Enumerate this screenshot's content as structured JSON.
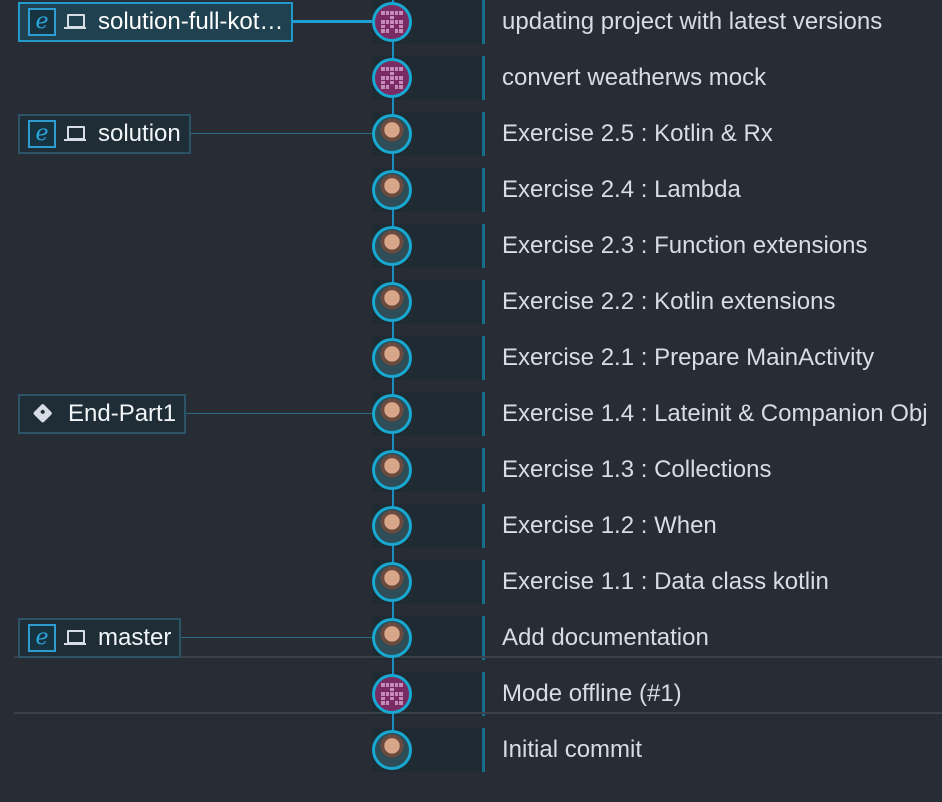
{
  "commits": [
    {
      "id": "c1",
      "message": "updating project with latest versions",
      "author": "identicon-purple"
    },
    {
      "id": "c2",
      "message": "convert weatherws mock",
      "author": "identicon-purple"
    },
    {
      "id": "c3",
      "message": "Exercise 2.5 : Kotlin & Rx",
      "author": "photo"
    },
    {
      "id": "c4",
      "message": "Exercise 2.4 : Lambda",
      "author": "photo"
    },
    {
      "id": "c5",
      "message": "Exercise 2.3 : Function extensions",
      "author": "photo"
    },
    {
      "id": "c6",
      "message": "Exercise 2.2 : Kotlin extensions",
      "author": "photo"
    },
    {
      "id": "c7",
      "message": "Exercise 2.1 : Prepare MainActivity",
      "author": "photo"
    },
    {
      "id": "c8",
      "message": "Exercise 1.4 : Lateinit & Companion Obj",
      "author": "photo"
    },
    {
      "id": "c9",
      "message": "Exercise 1.3 : Collections",
      "author": "photo"
    },
    {
      "id": "c10",
      "message": "Exercise 1.2 : When",
      "author": "photo"
    },
    {
      "id": "c11",
      "message": "Exercise 1.1 : Data class kotlin",
      "author": "photo"
    },
    {
      "id": "c12",
      "message": "Add documentation",
      "author": "photo"
    },
    {
      "id": "c13",
      "message": "Mode offline (#1)",
      "author": "identicon-purple"
    },
    {
      "id": "c14",
      "message": "Initial commit",
      "author": "photo"
    }
  ],
  "refs": [
    {
      "row": 0,
      "label": "solution-full-kot…",
      "type": "branch",
      "icons": [
        "e-icon",
        "computer-icon"
      ],
      "active": true
    },
    {
      "row": 2,
      "label": "solution",
      "type": "branch",
      "icons": [
        "e-icon",
        "computer-icon"
      ],
      "active": false
    },
    {
      "row": 7,
      "label": "End-Part1",
      "type": "tag",
      "icons": [
        "tag-icon"
      ],
      "active": false
    },
    {
      "row": 11,
      "label": "master",
      "type": "branch",
      "icons": [
        "e-icon",
        "computer-icon"
      ],
      "active": false
    }
  ],
  "colors": {
    "background": "#282c34",
    "graph_line": "#1b8fc1",
    "node_bg": "#1f2a33",
    "identicon": "#7b2b63"
  }
}
